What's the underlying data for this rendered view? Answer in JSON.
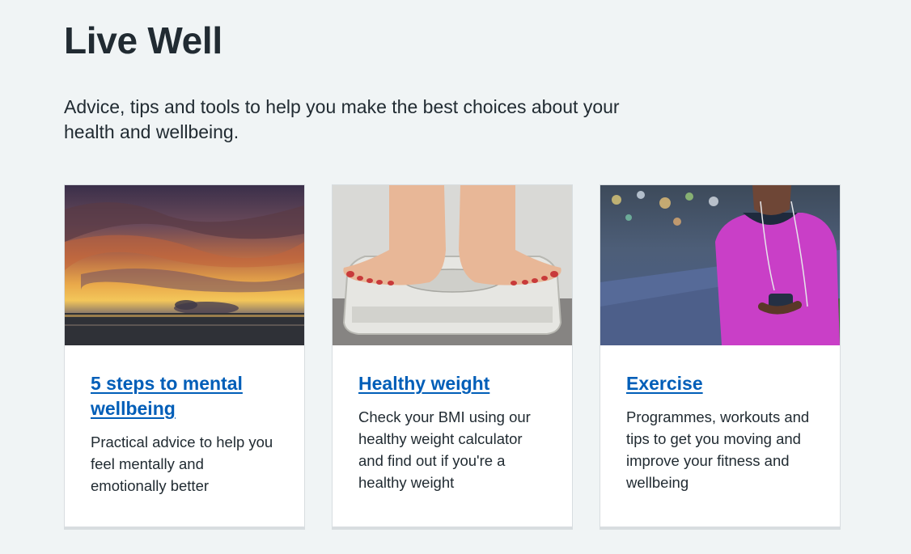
{
  "page": {
    "title": "Live Well",
    "lede": "Advice, tips and tools to help you make the best choices about your health and wellbeing."
  },
  "cards": [
    {
      "title": "5 steps to mental wellbeing",
      "description": "Practical advice to help you feel mentally and emotionally better",
      "image": "sunset-over-sea"
    },
    {
      "title": "Healthy weight",
      "description": "Check your BMI using our healthy weight calculator and find out if you're a healthy weight",
      "image": "feet-on-bathroom-scale"
    },
    {
      "title": "Exercise",
      "description": "Programmes, workouts and tips to get you moving and improve your fitness and wellbeing",
      "image": "woman-running-in-pink-top"
    }
  ],
  "colors": {
    "background": "#f0f4f5",
    "link": "#005eb8",
    "text": "#212b32",
    "card_border": "#d8dde0"
  }
}
